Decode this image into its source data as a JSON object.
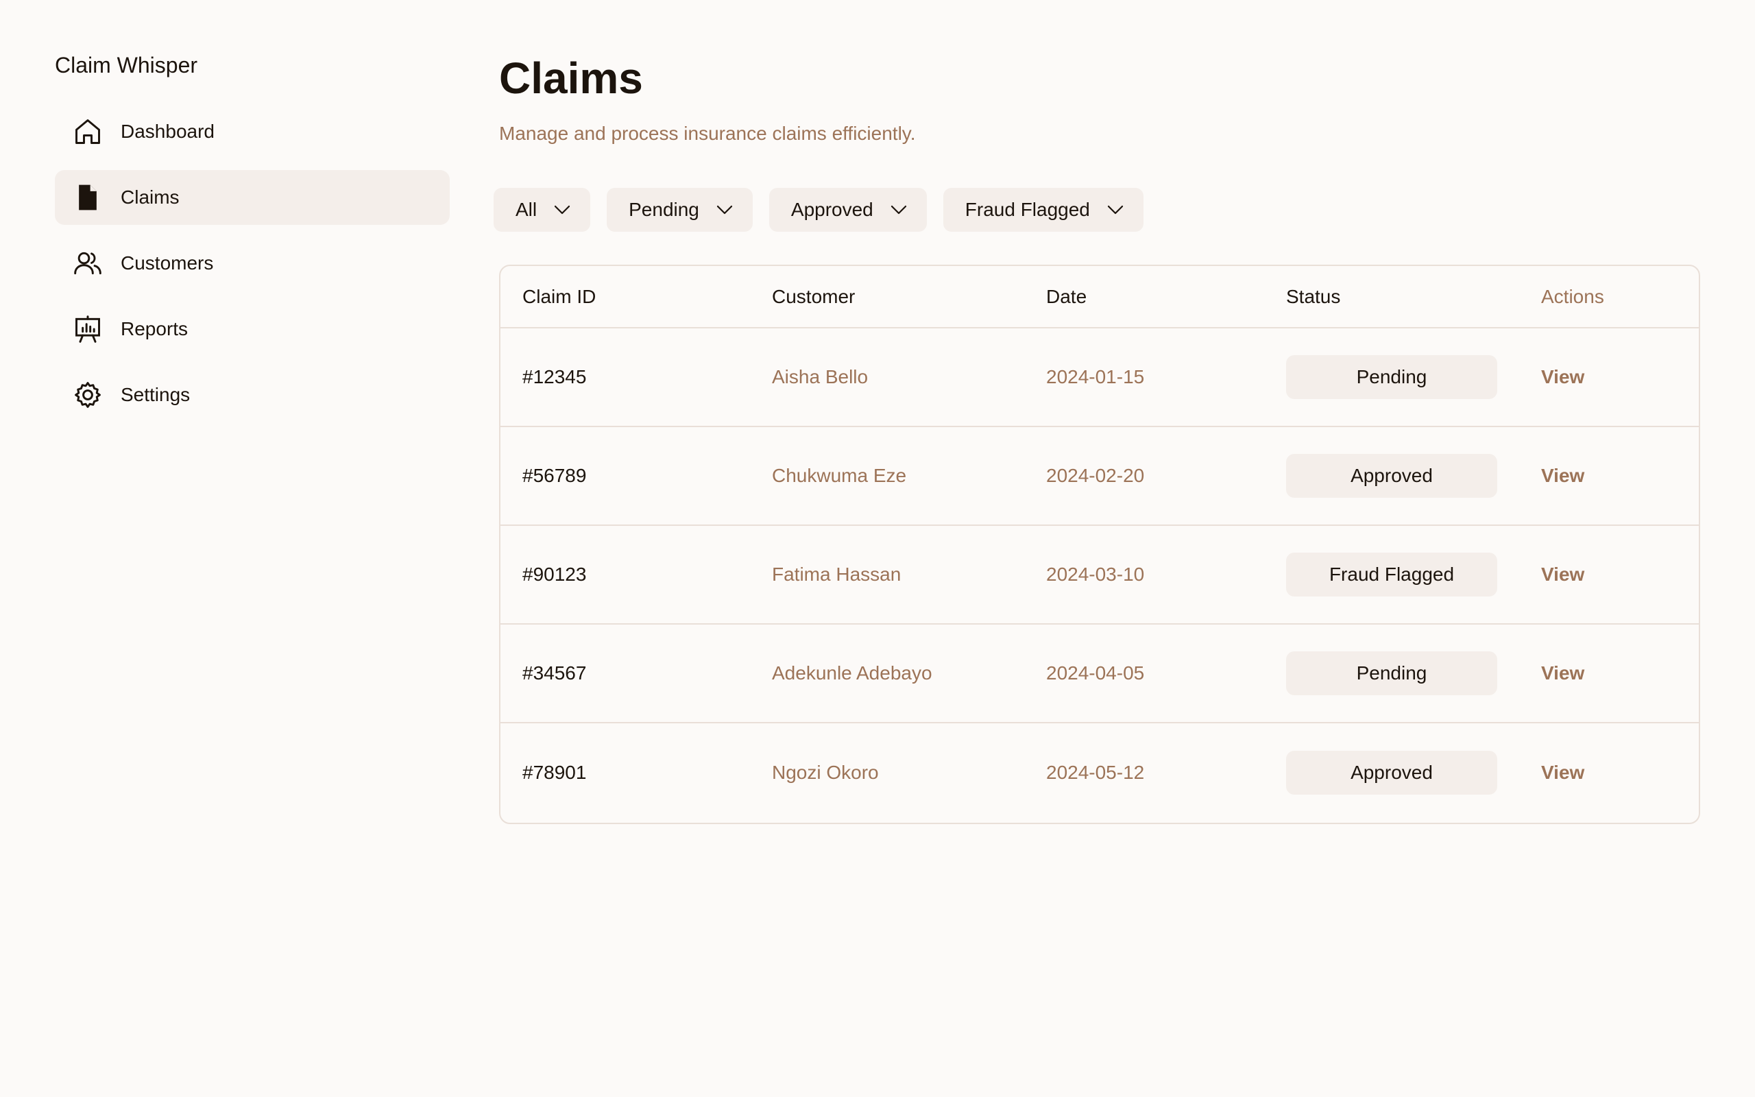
{
  "app": {
    "brand": "Claim Whisper"
  },
  "sidebar": {
    "items": [
      {
        "label": "Dashboard",
        "icon": "home-icon",
        "active": false
      },
      {
        "label": "Claims",
        "icon": "file-icon",
        "active": true
      },
      {
        "label": "Customers",
        "icon": "users-icon",
        "active": false
      },
      {
        "label": "Reports",
        "icon": "presentation-chart-icon",
        "active": false
      },
      {
        "label": "Settings",
        "icon": "gear-icon",
        "active": false
      }
    ]
  },
  "main": {
    "title": "Claims",
    "subtitle": "Manage and process insurance claims efficiently.",
    "filters": [
      {
        "label": "All"
      },
      {
        "label": "Pending"
      },
      {
        "label": "Approved"
      },
      {
        "label": "Fraud Flagged"
      }
    ],
    "table": {
      "headers": {
        "claim_id": "Claim ID",
        "customer": "Customer",
        "date": "Date",
        "status": "Status",
        "actions": "Actions"
      },
      "rows": [
        {
          "claim_id": "#12345",
          "customer": "Aisha Bello",
          "date": "2024-01-15",
          "status": "Pending",
          "action": "View"
        },
        {
          "claim_id": "#56789",
          "customer": "Chukwuma Eze",
          "date": "2024-02-20",
          "status": "Approved",
          "action": "View"
        },
        {
          "claim_id": "#90123",
          "customer": "Fatima Hassan",
          "date": "2024-03-10",
          "status": "Fraud Flagged",
          "action": "View"
        },
        {
          "claim_id": "#34567",
          "customer": "Adekunle Adebayo",
          "date": "2024-04-05",
          "status": "Pending",
          "action": "View"
        },
        {
          "claim_id": "#78901",
          "customer": "Ngozi Okoro",
          "date": "2024-05-12",
          "status": "Approved",
          "action": "View"
        }
      ]
    }
  },
  "colors": {
    "background": "#fcfaf8",
    "text": "#1c140d",
    "muted": "#9c7357",
    "chip": "#f4eeea",
    "border": "#e9dfd8"
  }
}
